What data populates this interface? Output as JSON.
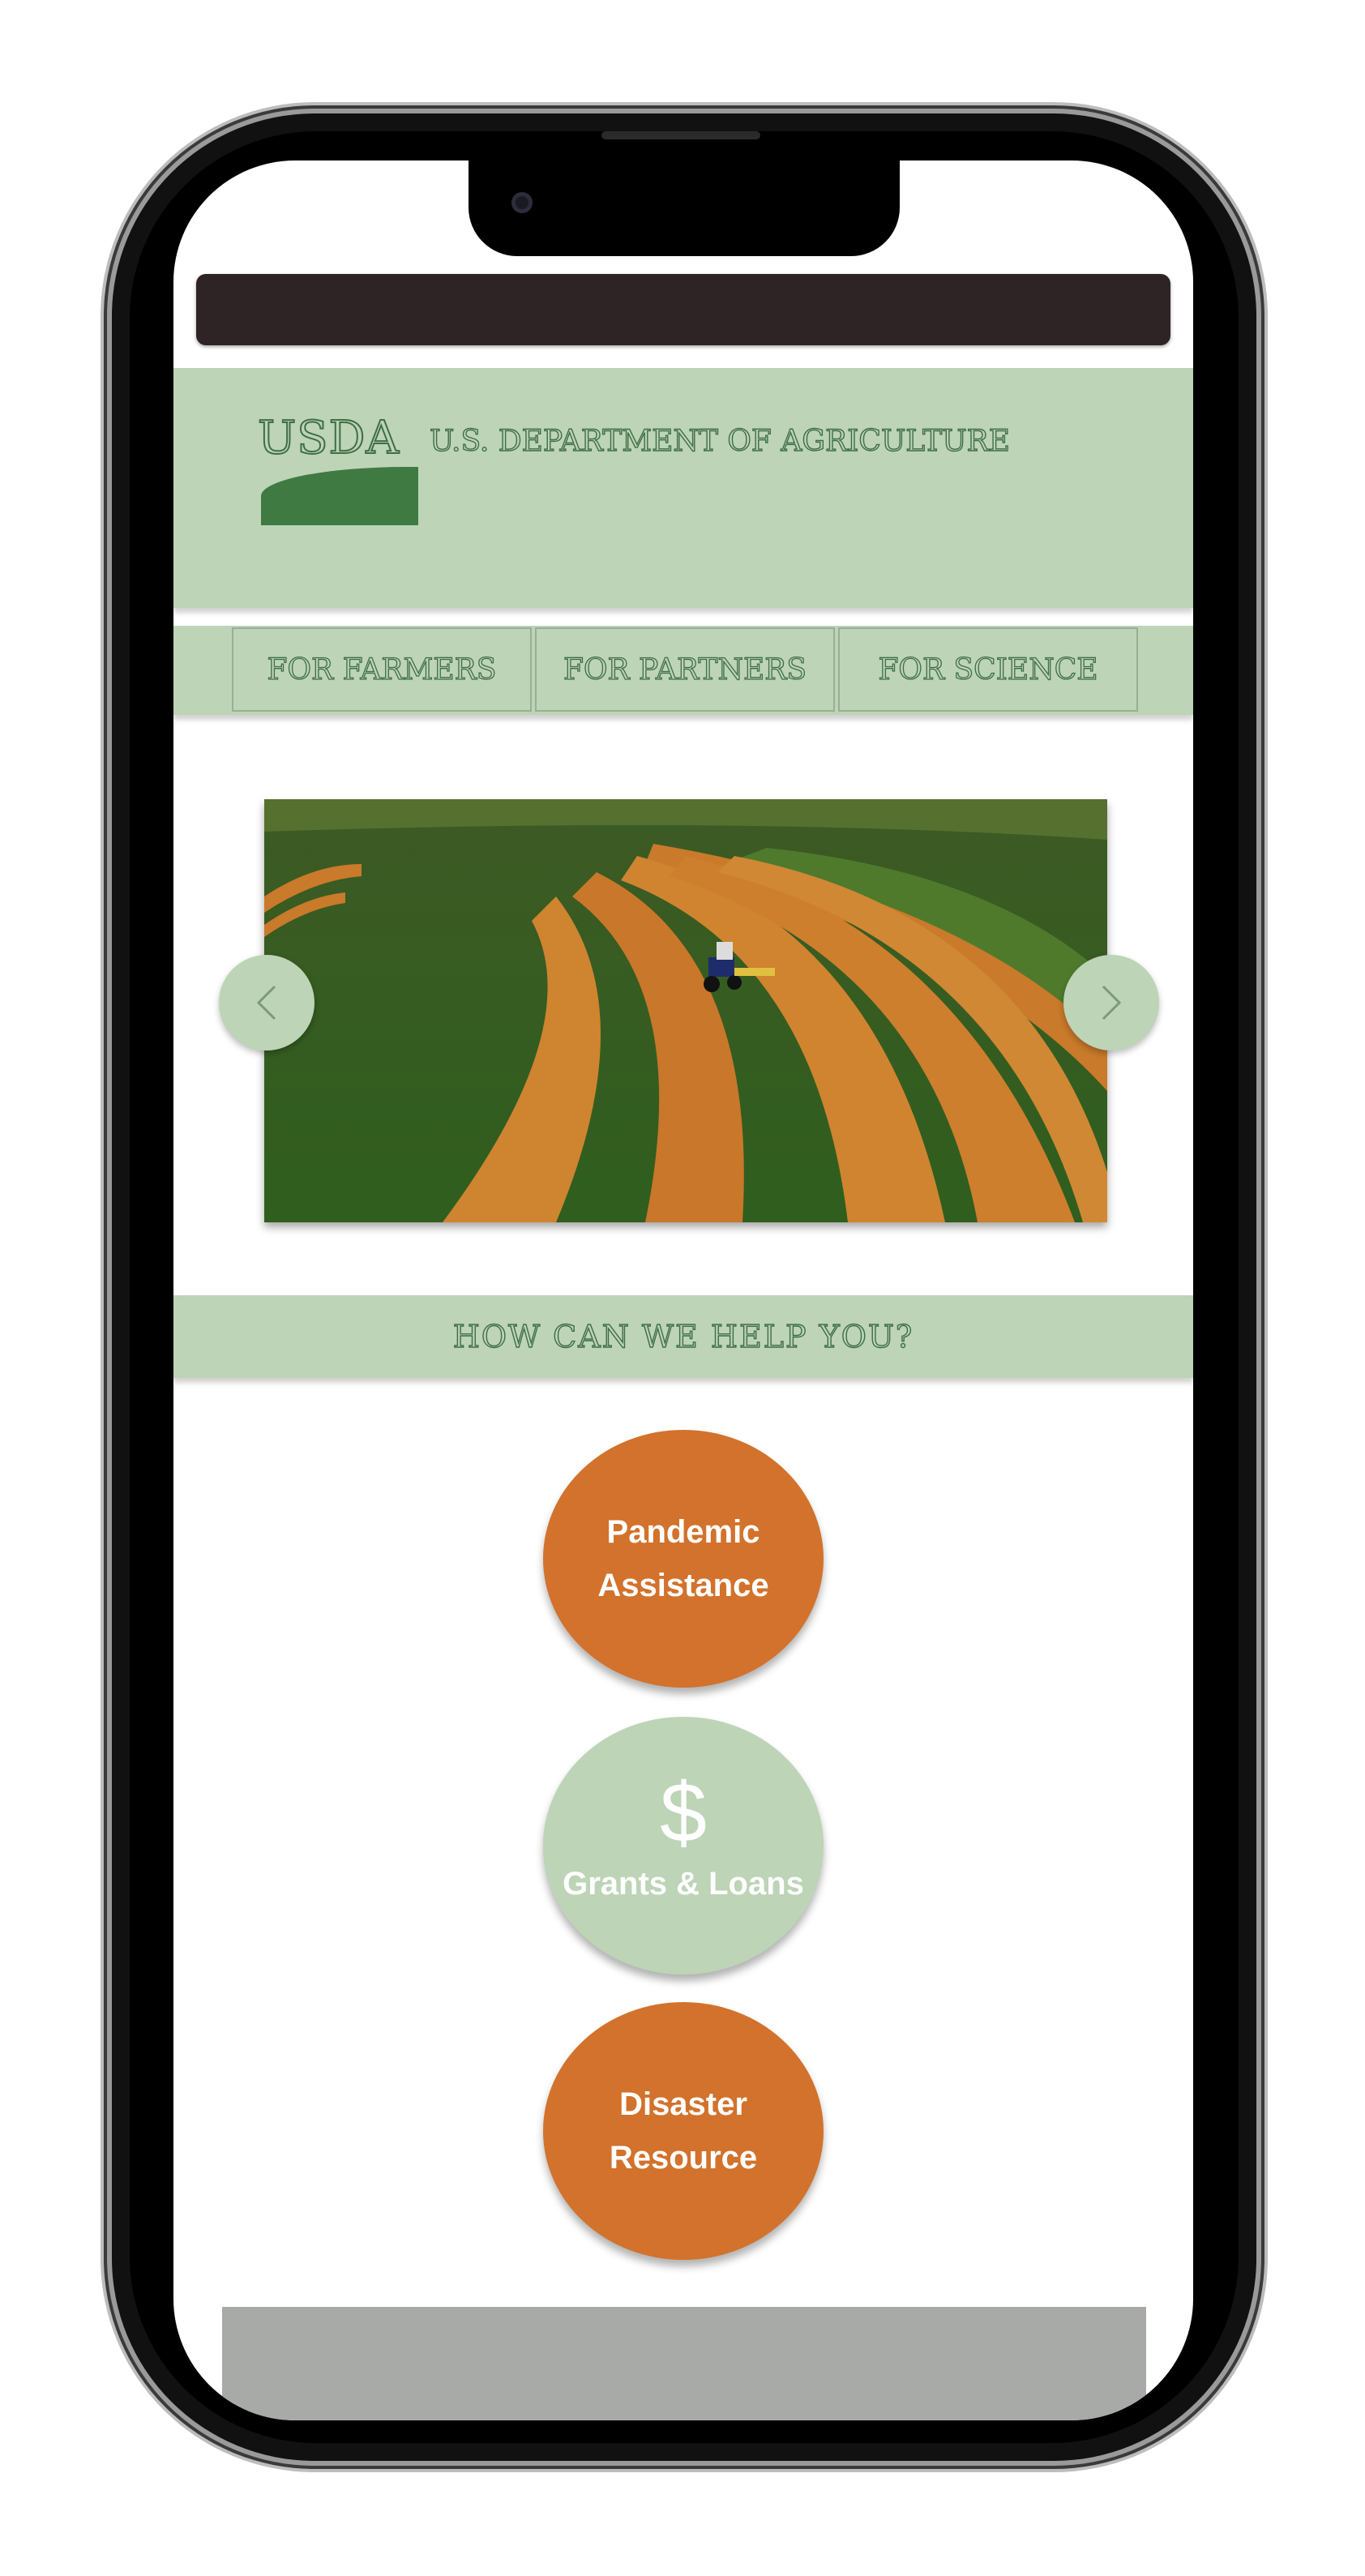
{
  "header": {
    "logo": "USDA",
    "title": "U.S. DEPARTMENT OF AGRICULTURE"
  },
  "nav": {
    "items": [
      {
        "label": "FOR FARMERS"
      },
      {
        "label": "FOR PARTNERS"
      },
      {
        "label": "FOR SCIENCE"
      }
    ]
  },
  "carousel": {
    "prev_icon": "chevron-left-icon",
    "next_icon": "chevron-right-icon"
  },
  "help": {
    "heading": "HOW CAN WE HELP YOU?"
  },
  "actions": [
    {
      "line1": "Pandemic",
      "line2": "Assistance",
      "color": "#d2722c"
    },
    {
      "icon": "$",
      "label": "Grants & Loans",
      "color": "#bdd4b7"
    },
    {
      "line1": "Disaster",
      "line2": "Resource",
      "color": "#d2722c"
    }
  ],
  "colors": {
    "sage": "#bdd4b7",
    "dark_green": "#3f6e45",
    "orange": "#d2722c",
    "topbar": "#2e2426",
    "footer": "#a7aaa6"
  }
}
